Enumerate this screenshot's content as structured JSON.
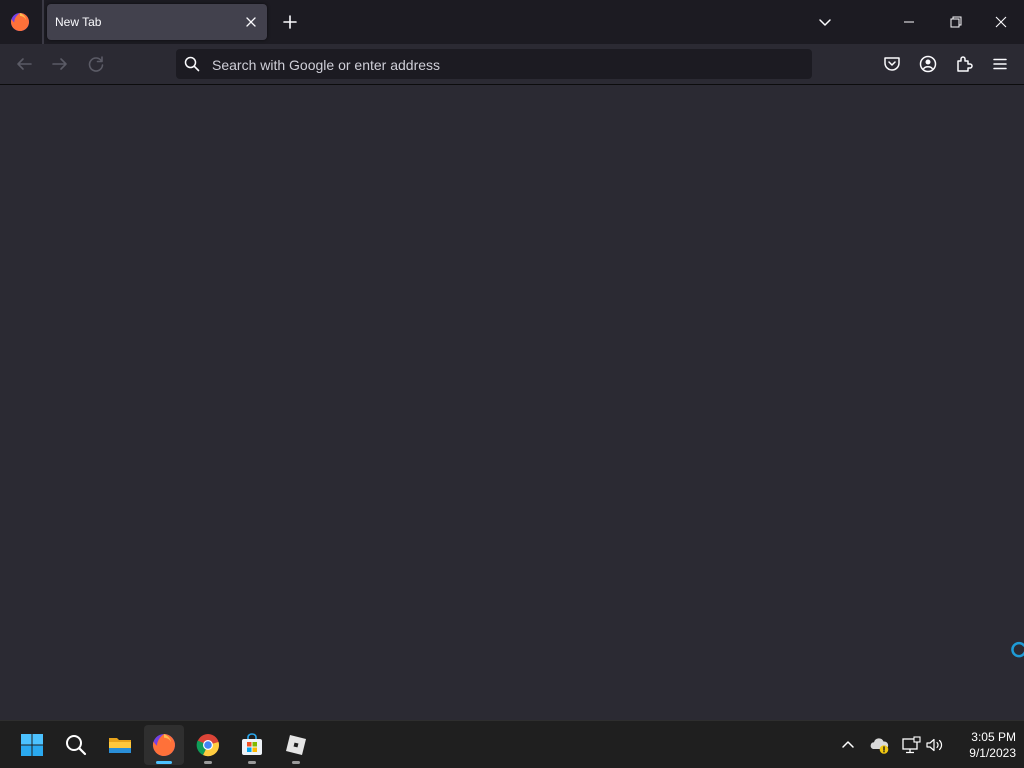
{
  "browser": {
    "tab": {
      "title": "New Tab"
    },
    "urlbar": {
      "placeholder": "Search with Google or enter address",
      "value": ""
    }
  },
  "taskbar": {
    "apps": [
      "windows-start",
      "search",
      "file-explorer",
      "firefox",
      "chrome",
      "microsoft-store",
      "roblox"
    ],
    "active_app": "firefox",
    "clock": {
      "time": "3:05 PM",
      "date": "9/1/2023"
    }
  },
  "colors": {
    "content_bg": "#2b2a33",
    "tabbar_bg": "#1c1b22",
    "active_indicator": "#4cc2ff"
  }
}
